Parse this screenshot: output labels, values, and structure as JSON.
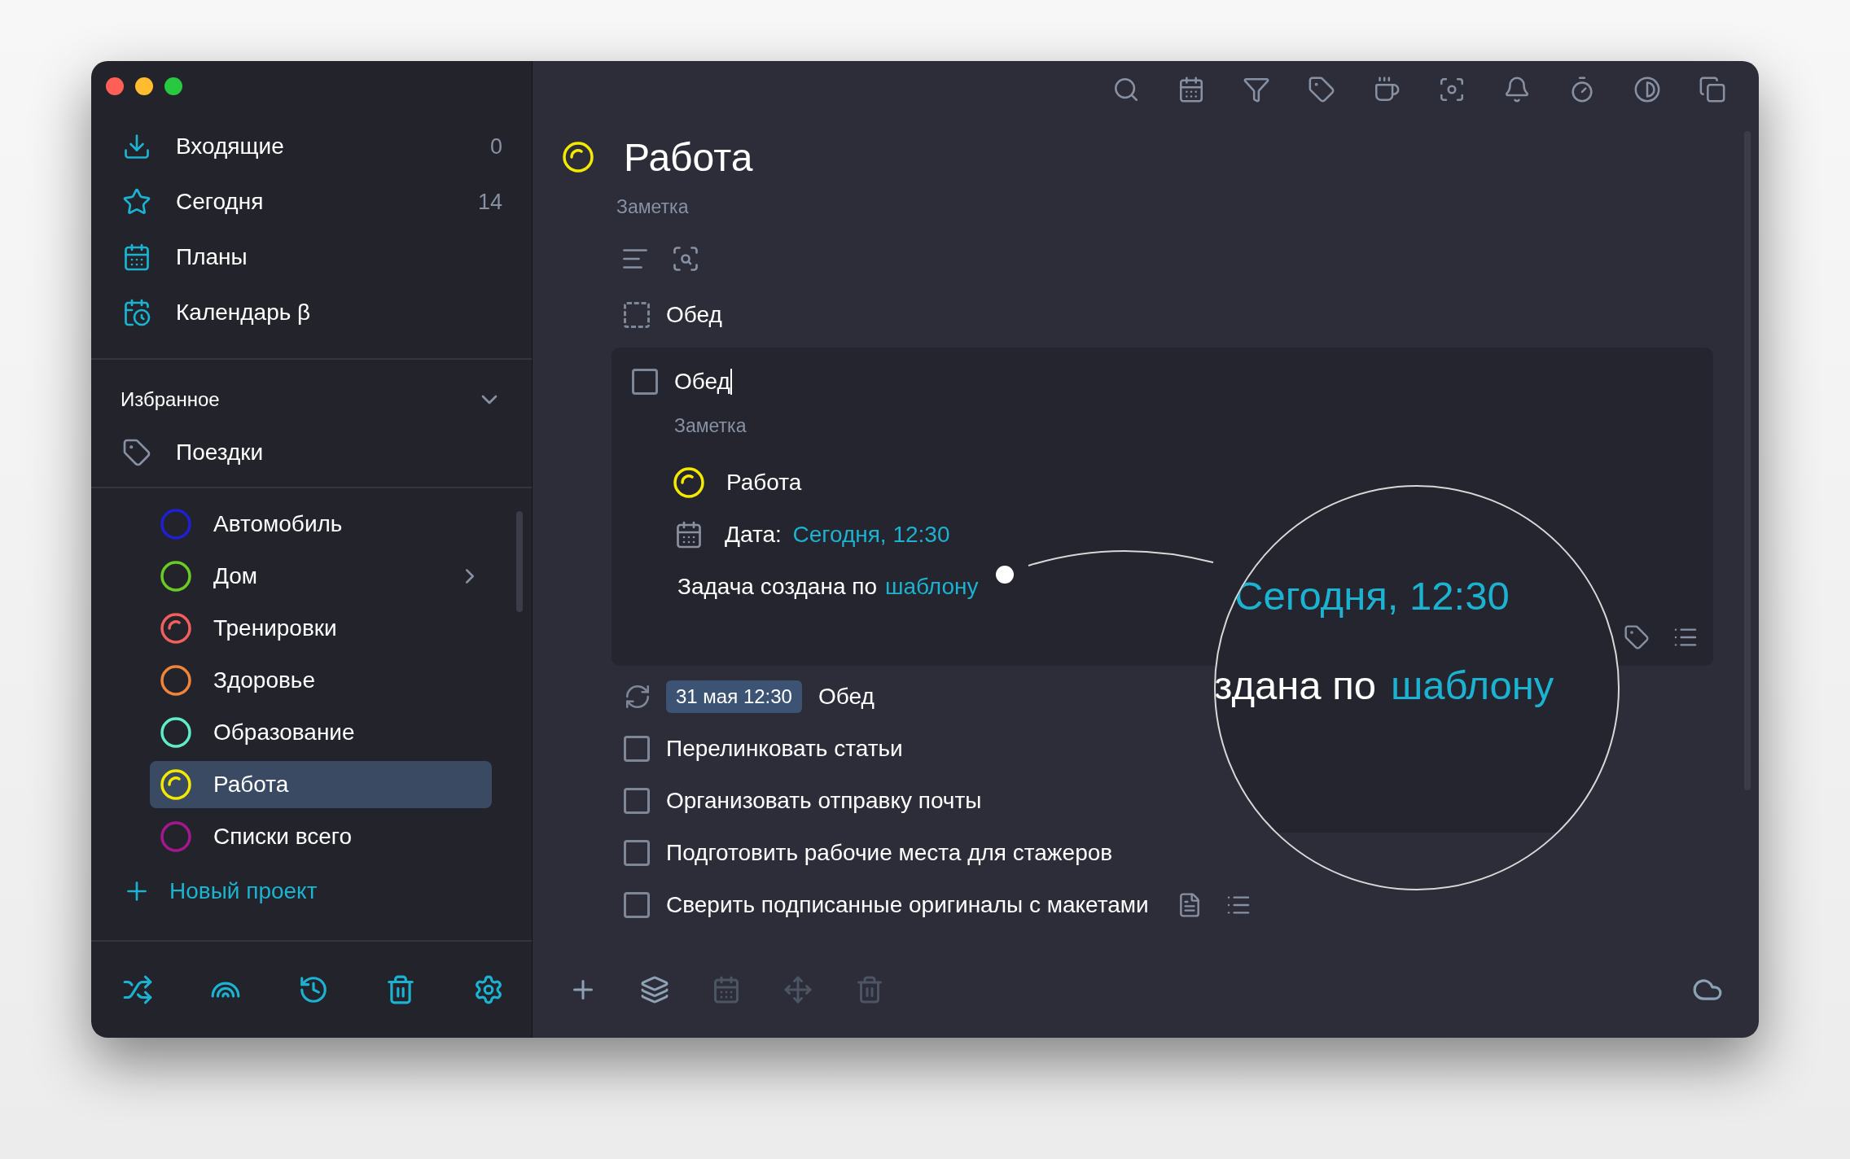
{
  "sidebar": {
    "nav": [
      {
        "kind": "inbox",
        "label": "Входящие",
        "count": "0"
      },
      {
        "kind": "today",
        "label": "Сегодня",
        "count": "14"
      },
      {
        "kind": "plans",
        "label": "Планы"
      },
      {
        "kind": "calendar",
        "label": "Календарь β"
      }
    ],
    "favorites": {
      "title": "Избранное",
      "expanded": true,
      "items": [
        {
          "label": "Поездки"
        }
      ]
    },
    "projects": [
      {
        "label": "Автомобиль",
        "color": "#1f1fd6",
        "progress": false,
        "expandable": false,
        "selected": false
      },
      {
        "label": "Дом",
        "color": "#6acc22",
        "progress": false,
        "expandable": true,
        "selected": false
      },
      {
        "label": "Тренировки",
        "color": "#f25f5c",
        "progress": true,
        "expandable": false,
        "selected": false
      },
      {
        "label": "Здоровье",
        "color": "#f2833a",
        "progress": false,
        "expandable": false,
        "selected": false
      },
      {
        "label": "Образование",
        "color": "#5eecc9",
        "progress": false,
        "expandable": false,
        "selected": false
      },
      {
        "label": "Работа",
        "color": "#f4e900",
        "progress": true,
        "expandable": false,
        "selected": true
      },
      {
        "label": "Списки всего",
        "color": "#a5168f",
        "progress": false,
        "expandable": false,
        "selected": false
      }
    ],
    "new_project": "Новый проект"
  },
  "main": {
    "title": "Работа",
    "color": "#f4e900",
    "note_placeholder": "Заметка",
    "tasks": [
      {
        "kind": "template",
        "title": "Обед",
        "checked": false
      },
      {
        "kind": "expanded",
        "title": "Обед",
        "checked": false,
        "note_placeholder": "Заметка",
        "project": "Работа",
        "date_label": "Дата:",
        "date_value": "Сегодня, 12:30",
        "origin_text": "Задача создана по",
        "origin_link": "шаблону"
      },
      {
        "kind": "recurring",
        "date": "31 мая 12:30",
        "title": "Обед"
      },
      {
        "kind": "task",
        "title": "Перелинковать статьи",
        "checked": false,
        "has_note": false,
        "has_subtasks": false
      },
      {
        "kind": "task",
        "title": "Организовать отправку почты",
        "checked": false,
        "has_note": false,
        "has_subtasks": false
      },
      {
        "kind": "task",
        "title": "Подготовить рабочие места для стажеров",
        "checked": false,
        "has_note": false,
        "has_subtasks": false
      },
      {
        "kind": "task",
        "title": "Сверить подписанные оригиналы с макетами",
        "checked": false,
        "has_note": true,
        "has_subtasks": true
      }
    ]
  },
  "magnifier": {
    "date_value": "Сегодня, 12:30",
    "text": "здана по",
    "link": "шаблону"
  }
}
